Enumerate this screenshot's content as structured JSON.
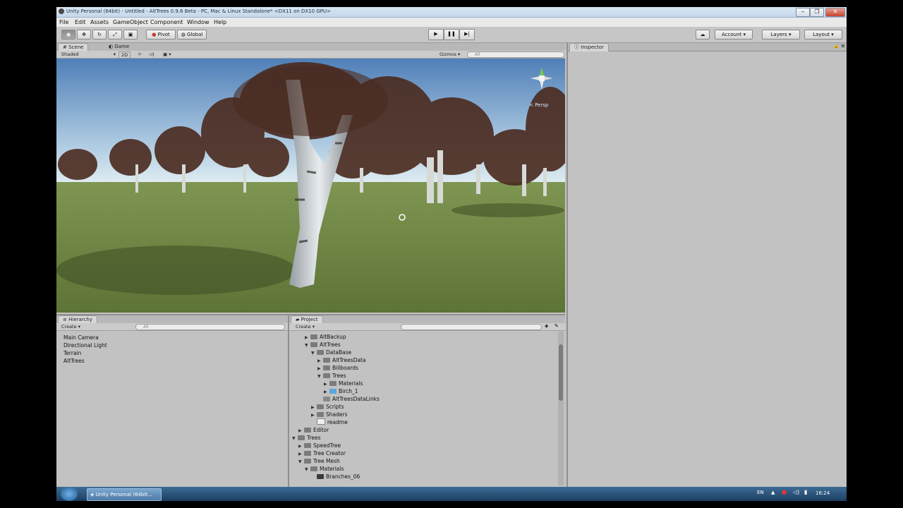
{
  "window": {
    "title": "Unity Personal (64bit) - Untitled - AltTrees 0.9.6 Beta - PC, Mac & Linux Standalone* <DX11 on DX10 GPU>"
  },
  "menu": [
    "File",
    "Edit",
    "Assets",
    "GameObject",
    "Component",
    "Window",
    "Help"
  ],
  "toolbar": {
    "pivot": "Pivot",
    "global": "Global",
    "account": "Account",
    "layers": "Layers",
    "layout": "Layout"
  },
  "scene": {
    "tab_scene": "Scene",
    "tab_game": "Game",
    "shading": "Shaded",
    "mode_2d": "2D",
    "gizmos": "Gizmos",
    "search_placeholder": "All",
    "persp": "< Persp"
  },
  "inspector": {
    "tab": "Inspector"
  },
  "hierarchy": {
    "tab": "Hierarchy",
    "create": "Create",
    "search_placeholder": "All",
    "items": [
      "Main Camera",
      "Directional Light",
      "Terrain",
      "AltTrees"
    ]
  },
  "project": {
    "tab": "Project",
    "create": "Create",
    "tree": [
      {
        "label": "AltBackup",
        "depth": 2,
        "arrow": "▶",
        "type": "folder"
      },
      {
        "label": "AltTrees",
        "depth": 2,
        "arrow": "▼",
        "type": "folder"
      },
      {
        "label": "DataBase",
        "depth": 3,
        "arrow": "▼",
        "type": "folder"
      },
      {
        "label": "AltTreesData",
        "depth": 4,
        "arrow": "▶",
        "type": "folder"
      },
      {
        "label": "Billboards",
        "depth": 4,
        "arrow": "▶",
        "type": "folder"
      },
      {
        "label": "Trees",
        "depth": 4,
        "arrow": "▼",
        "type": "folder"
      },
      {
        "label": "Materials",
        "depth": 5,
        "arrow": "▶",
        "type": "folder"
      },
      {
        "label": "Birch_1",
        "depth": 5,
        "arrow": "▶",
        "type": "prefab"
      },
      {
        "label": "AltTreesDataLinks",
        "depth": 4,
        "arrow": "",
        "type": "asset"
      },
      {
        "label": "Scripts",
        "depth": 3,
        "arrow": "▶",
        "type": "folder"
      },
      {
        "label": "Shaders",
        "depth": 3,
        "arrow": "▶",
        "type": "folder"
      },
      {
        "label": "readme",
        "depth": 3,
        "arrow": "",
        "type": "text"
      },
      {
        "label": "Editor",
        "depth": 1,
        "arrow": "▶",
        "type": "folder"
      },
      {
        "label": "Trees",
        "depth": 0,
        "arrow": "▼",
        "type": "folder"
      },
      {
        "label": "SpeedTree",
        "depth": 1,
        "arrow": "▶",
        "type": "folder"
      },
      {
        "label": "Tree Creator",
        "depth": 1,
        "arrow": "▶",
        "type": "folder"
      },
      {
        "label": "Tree Mesh",
        "depth": 1,
        "arrow": "▼",
        "type": "folder"
      },
      {
        "label": "Materials",
        "depth": 2,
        "arrow": "▼",
        "type": "folder"
      },
      {
        "label": "Branches_06",
        "depth": 3,
        "arrow": "",
        "type": "material"
      }
    ]
  },
  "taskbar": {
    "app": "Unity Personal (64bit...",
    "lang": "EN",
    "time": "16:24"
  }
}
